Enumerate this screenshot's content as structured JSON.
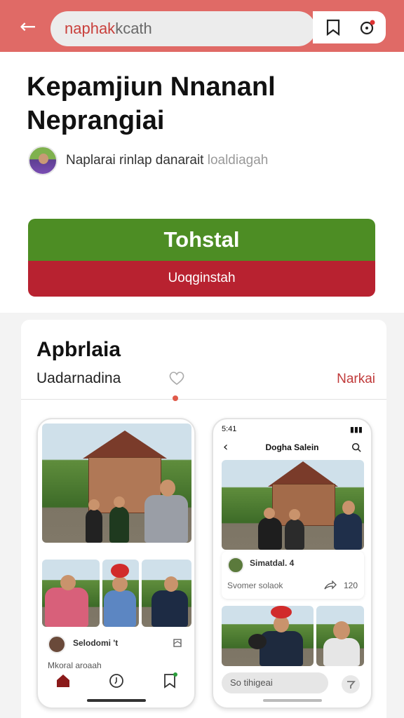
{
  "topbar": {
    "url_prefix": "naphak",
    "url_rest": "kcath",
    "colors": {
      "bar": "#e06a66",
      "accent": "#c9403c"
    }
  },
  "article": {
    "title_line1": "Kepamjiun Nnananl",
    "title_line2": "Neprangiai",
    "author_text": "Naplarai rinlap danarait",
    "author_soft": "loaldiagah"
  },
  "actions": {
    "primary_label": "Tohstal",
    "secondary_label": "Uoqginstah",
    "colors": {
      "primary": "#4d8d24",
      "secondary": "#b82230"
    }
  },
  "panel": {
    "title": "Apbrlaia",
    "tab_left": "Uadarnadina",
    "tab_right": "Narkai"
  },
  "phone1": {
    "profile_name": "Selodomi 't",
    "caption": "Mkoral aroaah"
  },
  "phone2": {
    "time": "5:41",
    "header": "Dogha Salein",
    "post_name": "Simatdal. 4",
    "post_caption": "Svomer solaok",
    "post_count": "120",
    "search_placeholder": "So tihigeai"
  }
}
